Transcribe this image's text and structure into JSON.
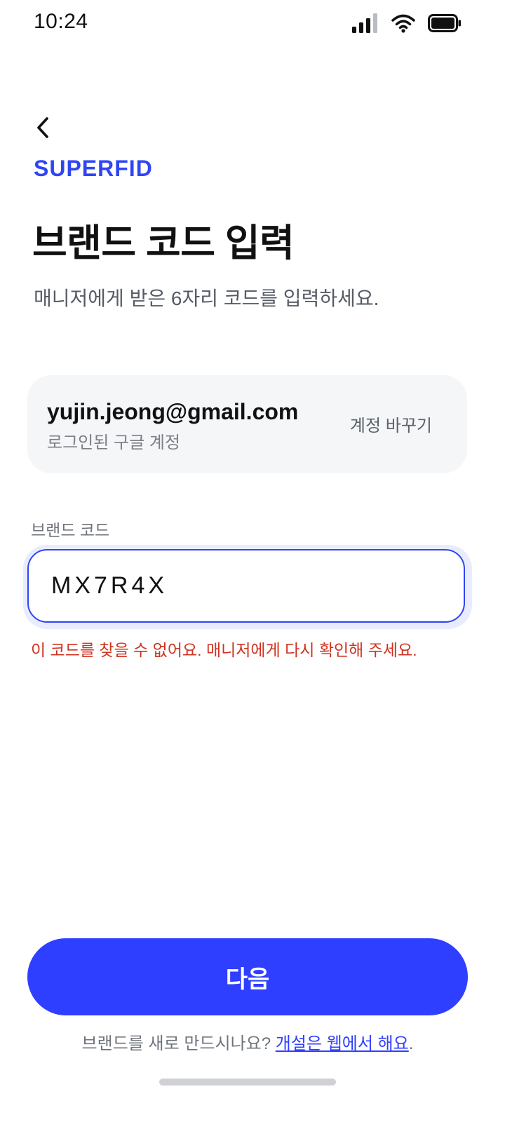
{
  "status_bar": {
    "time": "10:24"
  },
  "header": {
    "brand": "SUPERFID",
    "brand_color": "#2f45f5",
    "title": "브랜드 코드 입력",
    "subtitle": "매니저에게 받은 6자리 코드를 입력하세요."
  },
  "account": {
    "email": "yujin.jeong@gmail.com",
    "caption": "로그인된 구글 계정",
    "switch_label": "계정 바꾸기"
  },
  "code_field": {
    "label": "브랜드 코드",
    "value": "MX7R4X",
    "error": "이 코드를 찾을 수 없어요. 매니저에게 다시 확인해 주세요."
  },
  "actions": {
    "next_label": "다음",
    "button_color": "#2f3fff"
  },
  "footer": {
    "prompt": "브랜드를 새로 만드시나요? ",
    "link": "개설은 웹에서 해요",
    "suffix": "."
  },
  "icons": {
    "back": "chevron-left-icon",
    "signal": "cellular-signal-icon",
    "wifi": "wifi-icon",
    "battery": "battery-icon"
  },
  "error_color": "#d0321f"
}
